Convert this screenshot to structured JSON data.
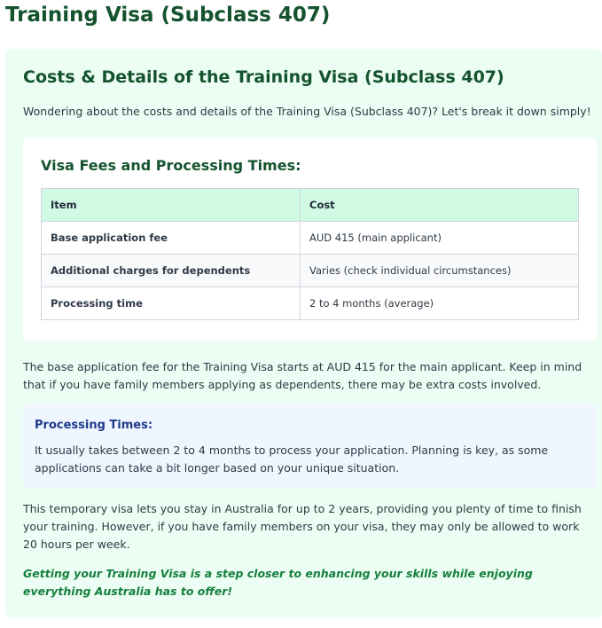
{
  "page": {
    "title": "Training Visa (Subclass 407)"
  },
  "section": {
    "heading": "Costs & Details of the Training Visa (Subclass 407)",
    "intro": "Wondering about the costs and details of the Training Visa (Subclass 407)? Let's break it down simply!"
  },
  "fees": {
    "heading": "Visa Fees and Processing Times:",
    "columns": [
      "Item",
      "Cost"
    ],
    "rows": [
      {
        "item": "Base application fee",
        "cost": "AUD 415 (main applicant)"
      },
      {
        "item": "Additional charges for dependents",
        "cost": "Varies (check individual circumstances)"
      },
      {
        "item": "Processing time",
        "cost": "2 to 4 months (average)"
      }
    ]
  },
  "paragraph_1": "The base application fee for the Training Visa starts at AUD 415 for the main applicant. Keep in mind that if you have family members applying as dependents, there may be extra costs involved.",
  "processing": {
    "heading": "Processing Times:",
    "text": "It usually takes between 2 to 4 months to process your application. Planning is key, as some applications can take a bit longer based on your unique situation."
  },
  "paragraph_2": "This temporary visa lets you stay in Australia for up to 2 years, providing you plenty of time to finish your training. However, if you have family members on your visa, they may only be allowed to work 20 hours per week.",
  "closing": "Getting your Training Visa is a step closer to enhancing your skills while enjoying everything Australia has to offer!",
  "colors": {
    "heading_green": "#14532d",
    "card_background": "#ecfdf3",
    "table_header": "#d1fae5",
    "info_box": "#eff6ff",
    "info_heading": "#1e3a8a",
    "closing_green": "#15803d"
  }
}
